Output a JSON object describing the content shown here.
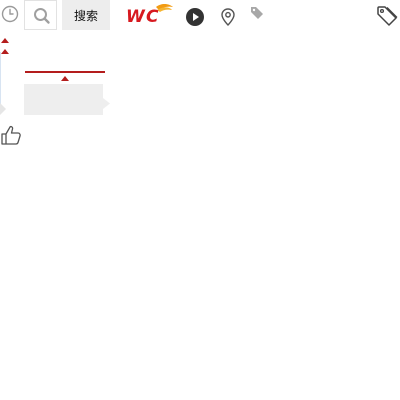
{
  "search": {
    "button_label": "搜索",
    "placeholder": ""
  },
  "brand": {
    "logo_name": "logo",
    "logo_text": "WC"
  },
  "icons": {
    "clock": "clock-icon",
    "search": "search-icon",
    "play": "play-icon",
    "location": "location-icon",
    "tag_small": "tag-icon",
    "tag_large": "tag-icon",
    "like": "thumbs-up-icon"
  },
  "colors": {
    "accent_red": "#b41d1d",
    "gray_block": "#eeeeee",
    "button_bg": "#ededed"
  }
}
